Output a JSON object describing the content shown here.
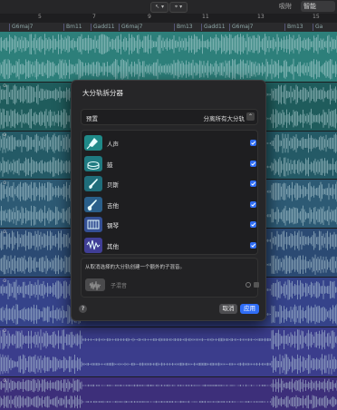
{
  "topbar": {
    "tool_pointer": "↖ ▾",
    "tool_marquee": "⌖ ▾",
    "snap_label": "吸附",
    "snap_value": "智能"
  },
  "ruler": {
    "bars": [
      "5",
      "7",
      "9",
      "11",
      "13",
      "15"
    ]
  },
  "chords": [
    "G6maj7",
    "Bm11",
    "Gadd11",
    "G6maj7",
    "Bm13",
    "Gadd11",
    "G6maj7",
    "Bm13",
    "Ga"
  ],
  "tracks": {
    "colors": [
      "#2d7f7a",
      "#1f5c5c",
      "#245a66",
      "#2d5a74",
      "#2b4a73",
      "#35438a",
      "#3b3d8c",
      "#3d2f7a"
    ]
  },
  "dialog": {
    "title": "大分轨拆分器",
    "preset_label": "预置",
    "preset_value": "分离所有大分轨",
    "preset_chevron": "⌃",
    "stems": [
      {
        "label": "人声",
        "icon": "microphone-icon",
        "color": "#1f8a88",
        "checked": true
      },
      {
        "label": "鼓",
        "icon": "drums-icon",
        "color": "#1f7a80",
        "checked": true
      },
      {
        "label": "贝斯",
        "icon": "bass-guitar-icon",
        "color": "#1f6d7a",
        "checked": true
      },
      {
        "label": "吉他",
        "icon": "guitar-icon",
        "color": "#2a5f8a",
        "checked": true
      },
      {
        "label": "钢琴",
        "icon": "piano-icon",
        "color": "#344f94",
        "checked": true
      },
      {
        "label": "其他",
        "icon": "waveform-icon",
        "color": "#403e96",
        "checked": true
      }
    ],
    "extra_text": "从取消选择的大分轨创建一个额外的子混音。",
    "submix_label": "子混音",
    "help_label": "?",
    "cancel_label": "取消",
    "apply_label": "应用"
  }
}
